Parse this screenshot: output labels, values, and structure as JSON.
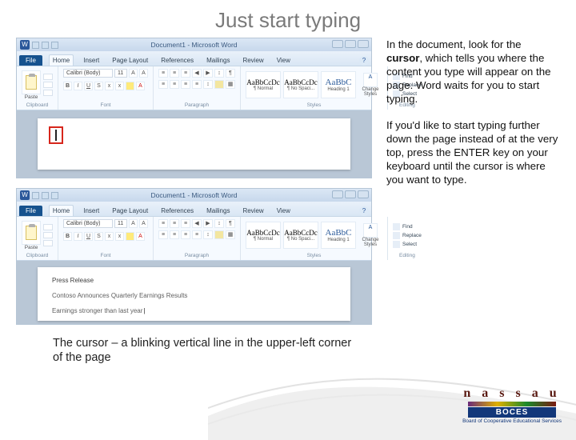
{
  "slide": {
    "title": "Just start typing",
    "caption": "The cursor – a blinking vertical line in the upper-left corner of the page"
  },
  "paragraphs": {
    "p1_a": "In the document, look for the ",
    "p1_b": "cursor",
    "p1_c": ", which tells you where the content you type will appear on the page. Word waits for you to start typing.",
    "p2": "If you'd like to start typing further down the page instead of at the very top, press the ENTER key on your keyboard until the cursor is where you want to type."
  },
  "word": {
    "title": "Document1 - Microsoft Word",
    "tabs": {
      "file": "File",
      "home": "Home",
      "insert": "Insert",
      "pagelayout": "Page Layout",
      "references": "References",
      "mailings": "Mailings",
      "review": "Review",
      "view": "View"
    },
    "groups": {
      "clipboard": "Clipboard",
      "font": "Font",
      "paragraph": "Paragraph",
      "styles": "Styles",
      "editing": "Editing"
    },
    "font": {
      "name": "Calibri (Body)",
      "size": "11"
    },
    "styles": {
      "s1_sample": "AaBbCcDc",
      "s1_name": "¶ Normal",
      "s2_sample": "AaBbCcDc",
      "s2_name": "¶ No Spaci...",
      "s3_sample": "AaBbC",
      "s3_name": "Heading 1",
      "change": "Change Styles"
    },
    "editing": {
      "find": "Find",
      "replace": "Replace",
      "select": "Select"
    },
    "paste": "Paste"
  },
  "doc2": {
    "line1": "Press Release",
    "line2": "Contoso Announces Quarterly Earnings Results",
    "line3": "Earnings stronger than last year"
  },
  "logo": {
    "brand": "n a s s a u",
    "sub": "BOCES",
    "tag": "Board of Cooperative Educational Services"
  }
}
